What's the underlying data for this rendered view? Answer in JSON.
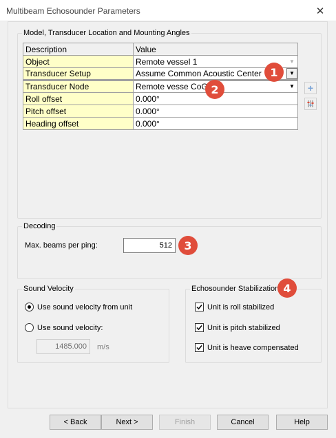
{
  "window": {
    "title": "Multibeam Echosounder Parameters",
    "close_glyph": "✕"
  },
  "model_group": {
    "title": "Model, Transducer Location and Mounting Angles",
    "headers": [
      "Description",
      "Value"
    ],
    "rows": [
      {
        "label": "Object",
        "value": "Remote vessel 1"
      },
      {
        "label": "Transducer Setup",
        "value": "Assume Common Acoustic Center"
      },
      {
        "label": "Transducer Node",
        "value": "Remote vesse CoG"
      },
      {
        "label": "Roll offset",
        "value": "0.000°"
      },
      {
        "label": "Pitch offset",
        "value": "0.000°"
      },
      {
        "label": "Heading offset",
        "value": "0.000°"
      }
    ],
    "add_glyph": "+"
  },
  "decoding": {
    "title": "Decoding",
    "max_beams_label": "Max.  beams per ping:",
    "max_beams_value": "512"
  },
  "sound_velocity": {
    "title": "Sound Velocity",
    "option_unit": "Use sound velocity from unit",
    "option_custom": "Use sound velocity:",
    "selected": "unit",
    "velocity_value": "1485.000",
    "velocity_unit": "m/s"
  },
  "stabilization": {
    "title": "Echosounder Stabilization",
    "roll": {
      "label": "Unit is roll stabilized",
      "checked": true
    },
    "pitch": {
      "label": "Unit is pitch stabilized",
      "checked": true
    },
    "heave": {
      "label": "Unit is heave compensated",
      "checked": true
    }
  },
  "badges": [
    "1",
    "2",
    "3",
    "4"
  ],
  "buttons": {
    "back": "< Back",
    "next": "Next >",
    "finish": "Finish",
    "cancel": "Cancel",
    "help": "Help"
  },
  "colors": {
    "badge": "#e04d3b",
    "label_cell": "#ffffc8",
    "accent_icon": "#7aa3d6"
  }
}
